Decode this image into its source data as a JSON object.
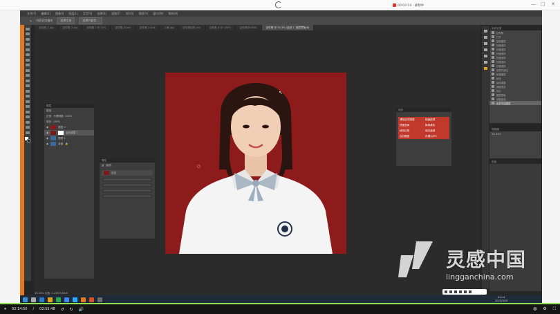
{
  "recorder": {
    "time": "00:02:14 · 录制中"
  },
  "menu": [
    "文件(F)",
    "编辑(E)",
    "图像(I)",
    "图层(L)",
    "文字(Y)",
    "选择(S)",
    "滤镜(T)",
    "3D(D)",
    "视图(V)",
    "窗口(W)",
    "帮助(H)"
  ],
  "options": {
    "label1": "内容识别填充",
    "btn1": "选择主体",
    "btn2": "选择并遮住..."
  },
  "tabs": [
    "证件照_1.jpg",
    "证件照_2.jpg",
    "未标题-1 @ 25%",
    "证件照_3.psd",
    "证件照_4.psd",
    "人像.jpg",
    "证件照红底.psd",
    "证件照_6 @ 100%",
    "证件照(RGB/8)",
    "证件照 @ 33.3% (曲线 1, 图层蒙版/8)"
  ],
  "layers": {
    "title": "图层",
    "kind": "类型",
    "mode": "正常",
    "opacity_label": "不透明度: 100%",
    "fill_label": "填充: 100%",
    "rows": [
      "图层 2",
      "曲线调整 1",
      "图层 1",
      "背景"
    ]
  },
  "properties": {
    "title": "属性",
    "item": "曲线",
    "preset": "自定"
  },
  "actions": {
    "title": "动作",
    "cells": [
      "清除证件照底",
      "快速选择",
      "快速选择",
      "换背景色",
      "填充红底",
      "填充蓝底",
      "合并图层",
      "存储为JPG"
    ]
  },
  "history": {
    "title": "历史记录",
    "items": [
      "证件照",
      "打开",
      "复制图层",
      "快速选择",
      "快速选择",
      "快速选择",
      "快速选择",
      "快速选择",
      "快速选择",
      "选择并遮住",
      "新建图层",
      "填充",
      "曲线调整",
      "通道混合",
      "色阶",
      "图层蒙版",
      "调整曲线",
      "合并可见图层"
    ]
  },
  "nav": {
    "title": "导航器",
    "zoom": "33.33%"
  },
  "swatches": {
    "title": "色板"
  },
  "status": {
    "zoom": "33.33%",
    "doc": "文档: 1.23M/5.64M"
  },
  "tray": {
    "time": "02:14",
    "date": "2023/3/15"
  },
  "player": {
    "current": "02:14:50",
    "total": "02:55:48"
  },
  "watermark": {
    "brand": "灵感中国",
    "url": "lingganchina.com"
  },
  "colors": {
    "accent": "#e8771f",
    "progress": "#8ee34d",
    "canvas_bg": "#8e1b1b",
    "action_red": "#c0392b"
  }
}
